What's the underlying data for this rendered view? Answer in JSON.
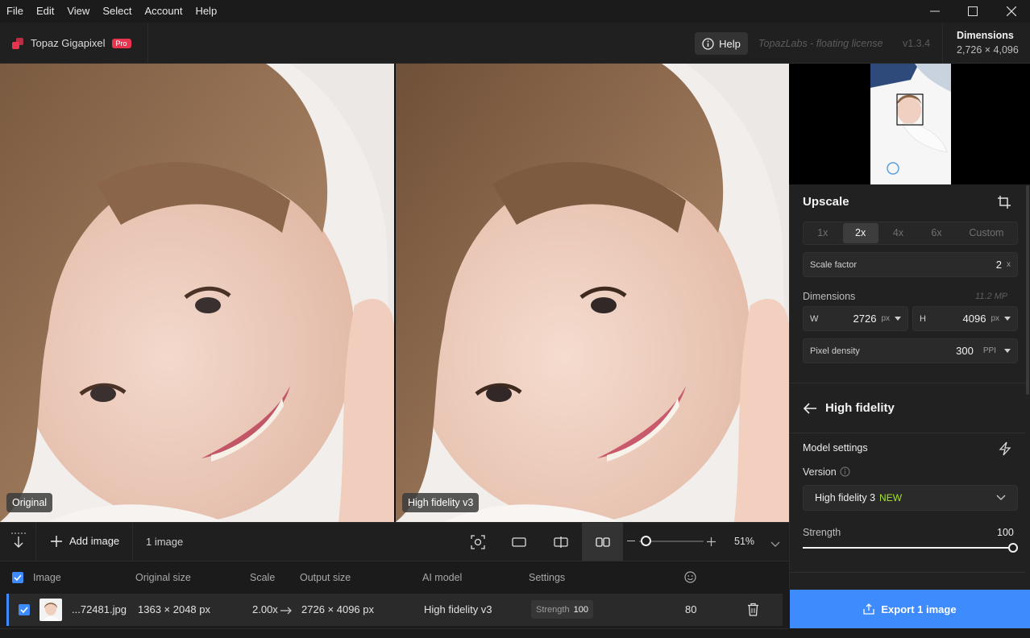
{
  "menu": [
    "File",
    "Edit",
    "View",
    "Select",
    "Account",
    "Help"
  ],
  "app": {
    "name": "Topaz Gigapixel",
    "badge": "Pro"
  },
  "header": {
    "help_label": "Help",
    "license": "TopazLabs - floating license",
    "version": "v1.3.4",
    "dimensions_title": "Dimensions",
    "dimensions_value": "2,726 × 4,096"
  },
  "viewer": {
    "left_label": "Original",
    "right_label": "High fidelity v3"
  },
  "upscale": {
    "title": "Upscale",
    "scales": [
      "1x",
      "2x",
      "4x",
      "6x",
      "Custom"
    ],
    "selected_scale": "2x",
    "scale_factor_label": "Scale factor",
    "scale_factor_value": "2",
    "scale_factor_unit": "x",
    "dimensions_label": "Dimensions",
    "megapixels": "11.2 MP",
    "width_label": "W",
    "width_value": "2726",
    "width_unit": "px",
    "height_label": "H",
    "height_value": "4096",
    "height_unit": "px",
    "density_label": "Pixel density",
    "density_value": "300",
    "density_unit": "PPI"
  },
  "model": {
    "title": "High fidelity",
    "settings_label": "Model settings",
    "version_label": "Version",
    "version_value": "High fidelity 3",
    "version_badge": "NEW",
    "strength_label": "Strength",
    "strength_value": "100",
    "strength_fraction": 1.0
  },
  "toolbar": {
    "add_image": "Add image",
    "image_count": "1 image",
    "zoom": "51%",
    "zoom_fraction": 0.1
  },
  "table": {
    "headers": [
      "Image",
      "Original size",
      "Scale",
      "Output size",
      "AI model",
      "Settings"
    ],
    "row": {
      "name": "...72481.jpg",
      "original": "1363 × 2048 px",
      "scale": "2.00x",
      "output": "2726 × 4096 px",
      "model": "High fidelity v3",
      "settings_label": "Strength",
      "settings_value": "100",
      "score": "80"
    }
  },
  "export": {
    "label": "Export 1 image"
  },
  "colors": {
    "accent": "#3d8bfd",
    "brand": "#e8344e",
    "new_badge": "#a6e22e"
  }
}
